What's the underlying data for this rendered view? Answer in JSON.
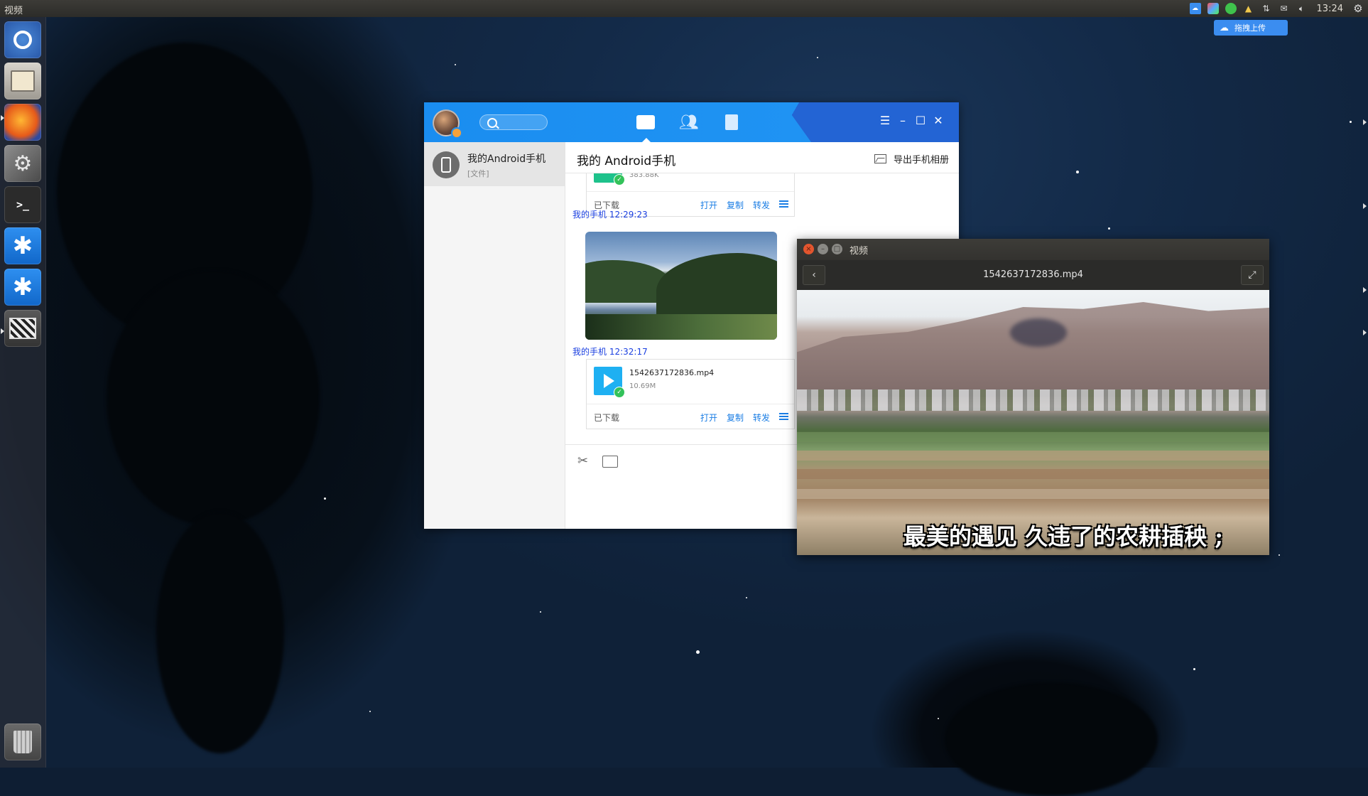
{
  "panel": {
    "app_title": "视频",
    "clock": "13:24",
    "tray_icons": [
      "baidu-netdisk-icon",
      "colorful-app-icon",
      "wechat-icon",
      "penguin-icon",
      "network-icon",
      "mail-icon",
      "volume-icon",
      "settings-gear-icon"
    ]
  },
  "upload_widget": {
    "label": "拖拽上传"
  },
  "launcher": {
    "items": [
      "ubuntu-dash",
      "file-manager",
      "firefox",
      "system-settings",
      "terminal",
      "app-star-1",
      "app-star-2",
      "video-player",
      "trash"
    ]
  },
  "qq": {
    "contact": {
      "name": "我的Android手机",
      "subtitle": "[文件]"
    },
    "chat_title": "我的 Android手机",
    "export_label": "导出手机相册",
    "messages": [
      {
        "type": "file",
        "size": "383.88K",
        "status": "已下载",
        "actions": [
          "打开",
          "复制",
          "转发"
        ]
      },
      {
        "type": "sender",
        "text": "我的手机  12:29:23"
      },
      {
        "type": "sender",
        "text": "我的手机  12:32:17"
      },
      {
        "type": "file",
        "name": "1542637172836.mp4",
        "size": "10.69M",
        "status": "已下载",
        "actions": [
          "打开",
          "复制",
          "转发"
        ]
      }
    ]
  },
  "video": {
    "window_title": "视频",
    "filename": "1542637172836.mp4",
    "subtitle": "最美的遇见 久违了的农耕插秧 ;"
  },
  "colors": {
    "qq_blue": "#1f93f3",
    "link_blue": "#1a7de4",
    "sender_blue": "#1a3fe0",
    "badge_green": "#33c25a"
  }
}
